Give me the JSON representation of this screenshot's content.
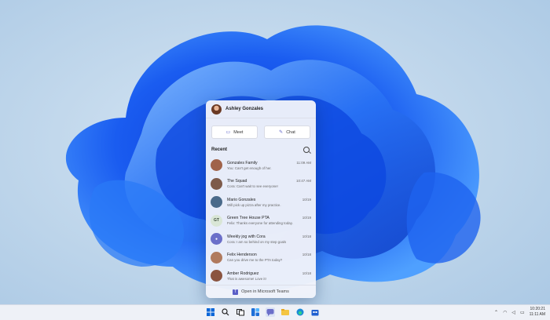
{
  "panel": {
    "user_name": "Ashley Gonzales",
    "meet_label": "Meet",
    "chat_label": "Chat",
    "recent_label": "Recent",
    "footer_label": "Open in Microsoft Teams",
    "chats": [
      {
        "name": "Gonzales Family",
        "time": "11:09 AM",
        "preview": "You: Can't get enough of her.",
        "avatar_color": "#a0634a"
      },
      {
        "name": "The Squad",
        "time": "10:47 AM",
        "preview": "Cora: Can't wait to see everyone!",
        "avatar_color": "#7d5a4a"
      },
      {
        "name": "Mario Gonzales",
        "time": "10/19",
        "preview": "Will pick up pizza after my practice.",
        "avatar_color": "#4a6a8a"
      },
      {
        "name": "Green Tree House PTA",
        "time": "10/19",
        "preview": "Felix: Thanks everyone for attending today.",
        "avatar_initials": "GT",
        "avatar_color": "#d9e6d6"
      },
      {
        "name": "Weekly jog with Cora",
        "time": "10/18",
        "preview": "Cora: I am so behind on my step goals",
        "avatar_color": "#6b6fc9"
      },
      {
        "name": "Felix Henderson",
        "time": "10/18",
        "preview": "Can you drive me to the PTA today?",
        "avatar_color": "#b07a5e"
      },
      {
        "name": "Amber Rodriguez",
        "time": "10/18",
        "preview": "That is awesome! Love it!",
        "avatar_color": "#8a5440"
      }
    ]
  },
  "taskbar": {
    "icons": [
      "windows-icon",
      "search-icon",
      "task-view-icon",
      "widgets-icon",
      "chat-icon",
      "file-explorer-icon",
      "edge-icon",
      "store-icon"
    ],
    "clock_time": "10:20:21",
    "clock_date": "11:11 AM"
  }
}
